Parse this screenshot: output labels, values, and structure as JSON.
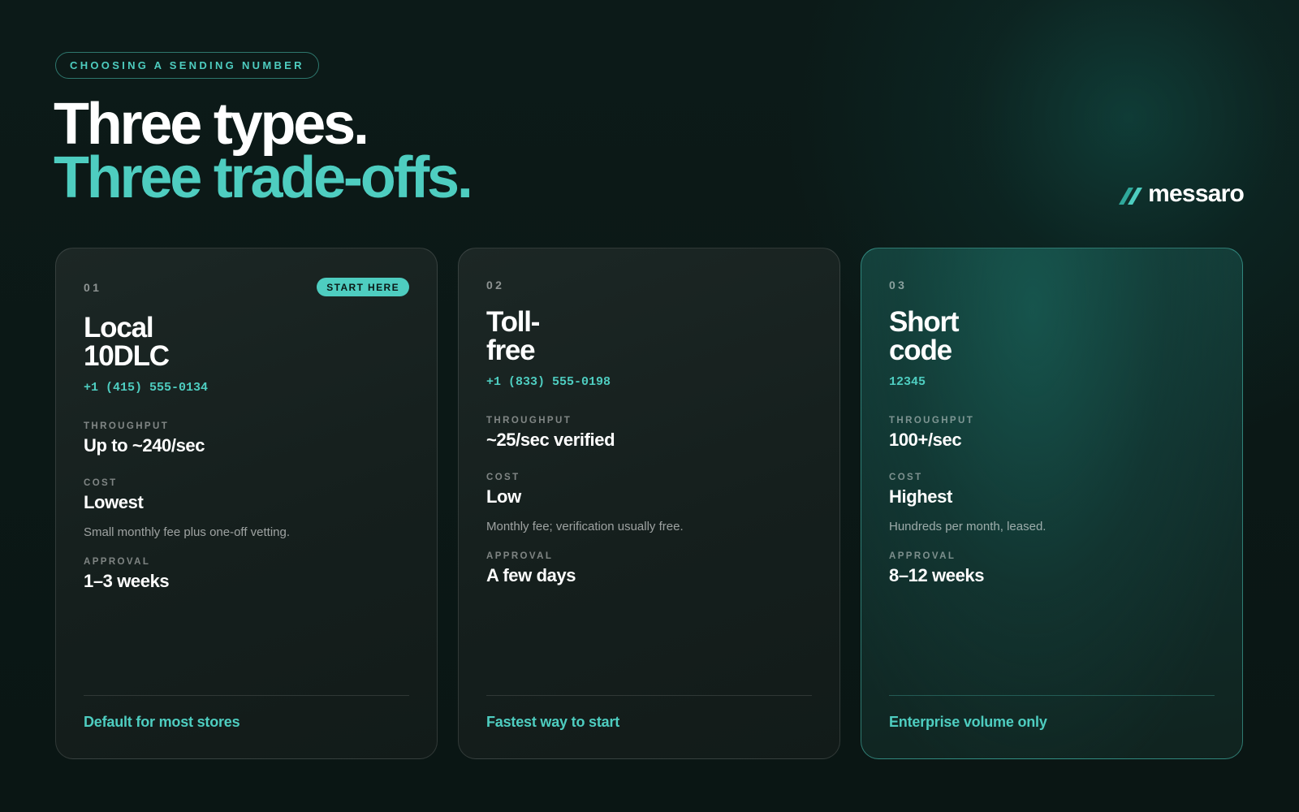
{
  "eyebrow": "CHOOSING A SENDING NUMBER",
  "headline": {
    "line1": "Three types.",
    "line2": "Three trade-offs."
  },
  "brand": {
    "name": "messaro",
    "icon": "messaro-logo-icon"
  },
  "colors": {
    "accent": "#4ecdc0",
    "background": "#0b1816",
    "card": "#1a2422",
    "featured_card": "#123a36"
  },
  "labels": {
    "throughput": "THROUGHPUT",
    "cost": "COST",
    "approval": "APPROVAL"
  },
  "cards": [
    {
      "number": "01",
      "badge": "START HERE",
      "title_line1": "Local",
      "title_line2": "10DLC",
      "phone": "+1 (415) 555-0134",
      "throughput": "Up to ~240/sec",
      "cost": "Lowest",
      "cost_note": "Small monthly fee plus one-off vetting.",
      "approval": "1–3 weeks",
      "footer": "Default for most stores"
    },
    {
      "number": "02",
      "title_line1": "Toll-",
      "title_line2": "free",
      "phone": "+1 (833) 555-0198",
      "throughput": "~25/sec verified",
      "cost": "Low",
      "cost_note": "Monthly fee; verification usually free.",
      "approval": "A few days",
      "footer": "Fastest way to start"
    },
    {
      "number": "03",
      "title_line1": "Short",
      "title_line2": "code",
      "phone": "12345",
      "throughput": "100+/sec",
      "cost": "Highest",
      "cost_note": "Hundreds per month, leased.",
      "approval": "8–12 weeks",
      "footer": "Enterprise volume only"
    }
  ]
}
